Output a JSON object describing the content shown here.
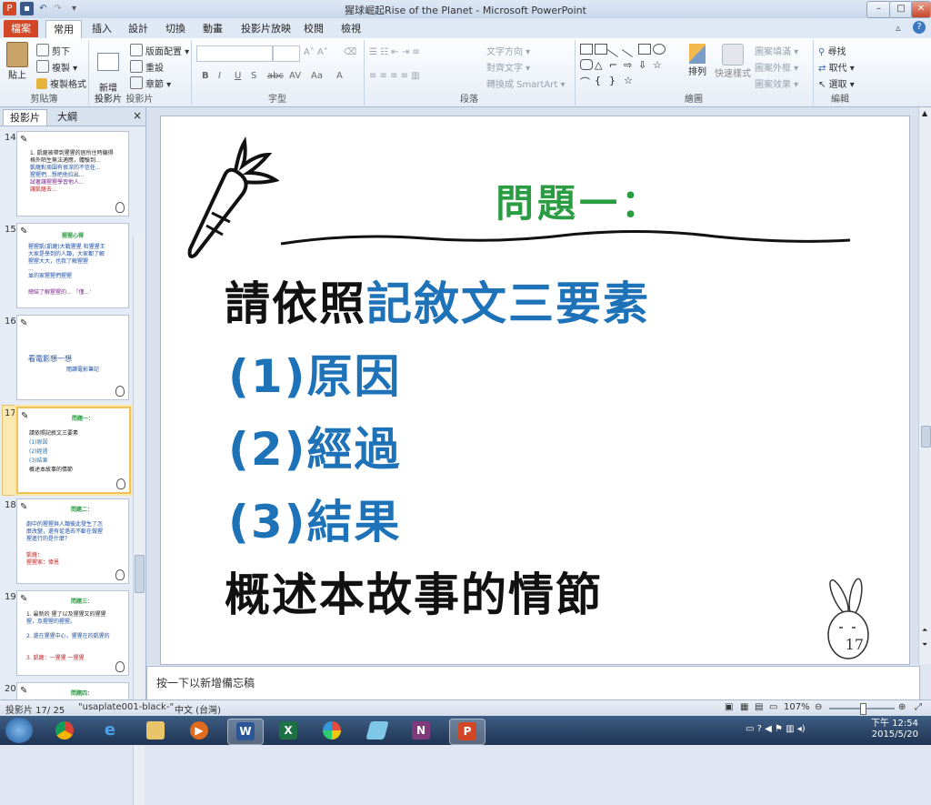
{
  "window": {
    "title": "猩球崛起Rise of the Planet - Microsoft PowerPoint",
    "app_icon": "P",
    "buttons": {
      "minimize": "–",
      "maximize": "□",
      "close": "✕"
    }
  },
  "ribbon_tabs": [
    "檔案",
    "常用",
    "插入",
    "設計",
    "切換",
    "動畫",
    "投影片放映",
    "校閱",
    "檢視"
  ],
  "ribbon": {
    "clipboard": {
      "paste": "貼上",
      "cut": "剪下",
      "copy": "複製",
      "format_painter": "複製格式",
      "label": "剪貼簿"
    },
    "slides": {
      "new_slide": "新增\n投影片",
      "layout": "版面配置",
      "reset": "重設",
      "section": "章節",
      "label": "投影片"
    },
    "font": {
      "label": "字型"
    },
    "paragraph": {
      "text_direction": "文字方向",
      "align_text": "對齊文字",
      "smartart": "轉換成 SmartArt",
      "label": "段落"
    },
    "drawing": {
      "arrange": "排列",
      "quick_styles": "快速樣式",
      "shape_fill": "圖案填滿",
      "shape_outline": "圖案外框",
      "shape_effects": "圖案效果",
      "label": "繪圖"
    },
    "editing": {
      "find": "尋找",
      "replace": "取代",
      "select": "選取",
      "label": "編輯"
    }
  },
  "left_panel": {
    "tabs": [
      "投影片",
      "大綱"
    ],
    "close": "×",
    "thumbnails": [
      {
        "num": "14",
        "title": "",
        "lines": [
          "1. 凱薩被帶到猩猩的居所住時顯得",
          "格外陌生無法適應，體驗到...",
          "凱薩對周圍有很深的不信任...",
          "猩猩們...想把他拉出...",
          "試著讓猩猩學習他人...",
          "讓凱薩去..."
        ]
      },
      {
        "num": "15",
        "title": "猩猩心得",
        "lines": [
          "猩猩凱(凱薩)大戰猩猩 和猩猩王",
          "大家是學到的人類，大家都了解",
          "猩猩大大，也我了解猩猩",
          "...",
          "並的家猩猩們猩猩",
          "總結了解猩猩的... 『僅...'"
        ]
      },
      {
        "num": "16",
        "title": "",
        "lines": [
          "看電影想一想",
          "閱讀電影筆記"
        ]
      },
      {
        "num": "17",
        "title": "問題一：",
        "lines": [
          "請依照記敘文三要素",
          "(1)原因",
          "(2)經過",
          "(3)結果",
          "概述本故事的情節"
        ]
      },
      {
        "num": "18",
        "title": "問題二：",
        "lines": [
          "劇中的猩猩與人類彼此發生了怎",
          "麼改變，還有從過去不斷在做猩",
          "猩進行的是什麼？",
          "",
          "凱薩：",
          "猩猩家：偉恩"
        ]
      },
      {
        "num": "19",
        "title": "問題三：",
        "lines": [
          "1. 最新的 猩了以及猩猩又的猩猩",
          "猩，及猩猩的猩猩。",
          "2. 還在猩猩中心，猩猩在的凱猩的",
          "3. 凱薩：一猩猩 一猩猩"
        ]
      },
      {
        "num": "20",
        "title": "問題四：",
        "lines": []
      }
    ]
  },
  "slide": {
    "title": "問題一：",
    "line1_black": "請依照",
    "line1_blue": "記敘文三要素",
    "items": [
      "(1)原因",
      "(2)經過",
      "(3)結果"
    ],
    "last_line": "概述本故事的情節",
    "page_number": "17"
  },
  "notes": {
    "placeholder": "按一下以新增備忘稿"
  },
  "status": {
    "slide_pos": "投影片 17/ 25",
    "theme": "\"usaplate001-black-\"",
    "language": "中文 (台灣)",
    "zoom": "107%"
  },
  "taskbar": {
    "time": "下午 12:54",
    "date": "2015/5/20",
    "apps": [
      "start",
      "chrome",
      "ie",
      "explorer",
      "media",
      "word",
      "excel",
      "picasa",
      "generic",
      "onenote",
      "powerpoint"
    ]
  },
  "colors": {
    "title_green": "#2a9d43",
    "accent_blue": "#1e72b8",
    "file_tab": "#d24726"
  }
}
